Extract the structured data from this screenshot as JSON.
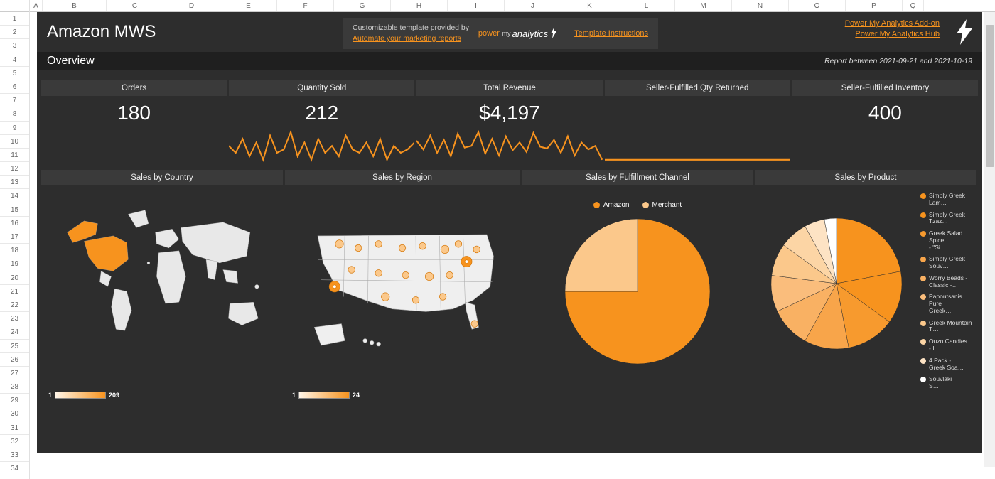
{
  "workbook": {
    "columns": [
      "A",
      "B",
      "C",
      "D",
      "E",
      "F",
      "G",
      "H",
      "I",
      "J",
      "K",
      "L",
      "M",
      "N",
      "O",
      "P",
      "Q"
    ],
    "rows": 34
  },
  "header": {
    "title": "Amazon MWS",
    "midbox": {
      "line1": "Customizable template provided by:",
      "line2": "Automate your marketing reports",
      "logo_prefix": "power",
      "logo_my": "my",
      "logo_word": "analytics",
      "template_link": "Template Instructions"
    },
    "right_links": [
      "Power My Analytics Add-on",
      "Power My Analytics Hub"
    ]
  },
  "overview": {
    "label": "Overview",
    "date_range": "Report between 2021-09-21 and 2021-10-19"
  },
  "metrics": [
    {
      "label": "Orders",
      "value": "180"
    },
    {
      "label": "Quantity Sold",
      "value": "212"
    },
    {
      "label": "Total Revenue",
      "value": "$4,197"
    },
    {
      "label": "Seller-Fulfilled Qty Returned",
      "value": ""
    },
    {
      "label": "Seller-Fulfilled Inventory",
      "value": "400"
    }
  ],
  "chart_data": [
    {
      "type": "line",
      "title": "Quantity Sold sparkline",
      "x": [
        1,
        2,
        3,
        4,
        5,
        6,
        7,
        8,
        9,
        10,
        11,
        12,
        13,
        14,
        15,
        16,
        17,
        18,
        19,
        20,
        21,
        22,
        23,
        24,
        25,
        26,
        27,
        28
      ],
      "values": [
        8,
        6,
        10,
        5,
        9,
        4,
        11,
        6,
        7,
        12,
        5,
        9,
        4,
        10,
        6,
        8,
        5,
        11,
        7,
        6,
        9,
        5,
        10,
        4,
        8,
        6,
        7,
        9
      ]
    },
    {
      "type": "line",
      "title": "Total Revenue sparkline",
      "x": [
        1,
        2,
        3,
        4,
        5,
        6,
        7,
        8,
        9,
        10,
        11,
        12,
        13,
        14,
        15,
        16,
        17,
        18,
        19,
        20,
        21,
        22,
        23,
        24,
        25,
        26,
        27,
        28
      ],
      "values": [
        170,
        120,
        200,
        100,
        175,
        80,
        210,
        130,
        140,
        220,
        95,
        180,
        85,
        195,
        115,
        160,
        105,
        215,
        135,
        125,
        175,
        100,
        195,
        85,
        160,
        120,
        140,
        60
      ]
    },
    {
      "type": "line",
      "title": "Seller-Fulfilled Qty Returned sparkline",
      "x": [
        1,
        2,
        3,
        4,
        5,
        6,
        7,
        8,
        9,
        10,
        11,
        12,
        13,
        14,
        15,
        16,
        17,
        18,
        19,
        20,
        21,
        22,
        23,
        24,
        25,
        26,
        27,
        28
      ],
      "values": [
        0,
        0,
        0,
        0,
        0,
        0,
        0,
        0,
        0,
        0,
        0,
        0,
        0,
        0,
        0,
        0,
        0,
        0,
        0,
        0,
        0,
        0,
        0,
        0,
        0,
        0,
        0,
        0
      ]
    },
    {
      "type": "map",
      "title": "Sales by Country",
      "scale_min": 1,
      "scale_max": 209,
      "legend_min": "1",
      "legend_max": "209"
    },
    {
      "type": "map",
      "title": "Sales by Region",
      "scale_min": 1,
      "scale_max": 24,
      "legend_min": "1",
      "legend_max": "24"
    },
    {
      "type": "pie",
      "title": "Sales by Fulfillment Channel",
      "series": [
        {
          "name": "Amazon",
          "value": 75,
          "color": "#f7931e"
        },
        {
          "name": "Merchant",
          "value": 25,
          "color": "#fbc88b"
        }
      ]
    },
    {
      "type": "pie",
      "title": "Sales by Product",
      "series": [
        {
          "name": "Simply Greek Lam…",
          "value": 22,
          "color": "#f7931e"
        },
        {
          "name": "Simply Greek Tzaz…",
          "value": 13,
          "color": "#f7931e"
        },
        {
          "name": "Greek Salad Spice - \"Si…",
          "value": 12,
          "color": "#f79a2e"
        },
        {
          "name": "Simply Greek Souv…",
          "value": 11,
          "color": "#f8a54a"
        },
        {
          "name": "Worry Beads - Classic -…",
          "value": 10,
          "color": "#f9b163"
        },
        {
          "name": "Papoutsanis Pure Greek…",
          "value": 9,
          "color": "#fabd7c"
        },
        {
          "name": "Greek Mountain T…",
          "value": 8,
          "color": "#fbc88b"
        },
        {
          "name": "Ouzo Candies - I…",
          "value": 7,
          "color": "#fcd5a5"
        },
        {
          "name": "4 Pack - Greek Soa…",
          "value": 5,
          "color": "#fde3c4"
        },
        {
          "name": "Souvlaki S…",
          "value": 3,
          "color": "#ffffff"
        }
      ]
    }
  ],
  "chart_titles": {
    "country": "Sales by Country",
    "region": "Sales by Region",
    "channel": "Sales by Fulfillment Channel",
    "product": "Sales by Product"
  }
}
